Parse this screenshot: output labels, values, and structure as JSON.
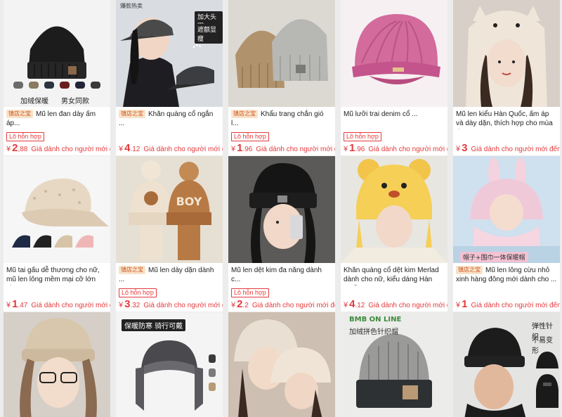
{
  "products": [
    {
      "img_text": [
        "加绒保暖",
        "男女同款"
      ],
      "img_tag": "",
      "shop_tag": "镇店之宝",
      "title": "Mũ len đan dày ấm áp...",
      "badge": "Lô hỗn hợp",
      "currency": "¥",
      "price_int": "2",
      "price_dec": ",88",
      "note": "Giá dành cho người mới đến",
      "icon": "beanie-hat-icon"
    },
    {
      "img_text": [
        "加大头围",
        "遮额显瘦"
      ],
      "img_tag": "爆款热卖",
      "shop_tag": "镇店之宝",
      "title": "Khăn quàng cổ ngắn ...",
      "badge": "",
      "currency": "¥",
      "price_int": "4",
      "price_dec": ".12",
      "note": "Giá dành cho người mới đến",
      "icon": "baseball-cap-icon"
    },
    {
      "img_text": [],
      "img_tag": "",
      "shop_tag": "镇店之宝",
      "title": "Khẩu trang chắn gió l...",
      "badge": "Lô hỗn hợp",
      "currency": "¥",
      "price_int": "1",
      "price_dec": ".96",
      "note": "Giá dành cho người mới đến",
      "icon": "knit-hat-icon"
    },
    {
      "img_text": [],
      "img_tag": "",
      "shop_tag": "",
      "title": "Mũ lưỡi trai denim cổ ...",
      "badge": "Lô hỗn hợp",
      "currency": "¥",
      "price_int": "1",
      "price_dec": ".96",
      "note": "Giá dành cho người mới đến",
      "icon": "newsboy-cap-icon"
    },
    {
      "img_text": [],
      "img_tag": "",
      "shop_tag": "",
      "title": "Mũ len kiểu Hàn Quốc, ấm áp và dày dặn, thích hợp cho mùa thu...",
      "badge": "",
      "currency": "¥",
      "price_int": "3",
      "price_dec": "",
      "note": "Giá dành cho người mới đến",
      "icon": "plush-hat-icon"
    },
    {
      "img_text": [],
      "img_tag": "",
      "shop_tag": "",
      "title": "Mũ tai gấu dễ thương cho nữ, mũ len lông mềm mại cỡ lớn cho ...",
      "badge": "",
      "currency": "¥",
      "price_int": "1",
      "price_dec": ".47",
      "note": "Giá dành cho người mới đến",
      "icon": "teddy-cap-icon"
    },
    {
      "img_text": [],
      "img_tag": "",
      "shop_tag": "镇店之宝",
      "title": "Mũ len dày dặn dành ...",
      "badge": "Lô hỗn hợp",
      "currency": "¥",
      "price_int": "3",
      "price_dec": ".32",
      "note": "Giá dành cho người mới đến",
      "icon": "pompom-hat-icon"
    },
    {
      "img_text": [],
      "img_tag": "",
      "shop_tag": "",
      "title": "Mũ len dệt kim đa năng dành c...",
      "badge": "Lô hỗn hợp",
      "currency": "¥",
      "price_int": "2",
      "price_dec": ".2",
      "note": "Giá dành cho người mới đến",
      "icon": "dark-beanie-icon"
    },
    {
      "img_text": [],
      "img_tag": "",
      "shop_tag": "",
      "title": "Khăn quàng cổ dệt kim Merlad dành cho nữ, kiểu dáng Hàn Quố...",
      "badge": "",
      "currency": "¥",
      "price_int": "4",
      "price_dec": ".12",
      "note": "Giá dành cho người mới đến",
      "icon": "bear-hat-icon"
    },
    {
      "img_text": [
        "帽子+围巾一体保暖帽"
      ],
      "img_tag": "",
      "shop_tag": "镇店之宝",
      "title": "Mũ len lông cừu nhỏ xinh hàng đông mới dành cho ...",
      "badge": "",
      "currency": "¥",
      "price_int": "1",
      "price_dec": "",
      "note": "Giá dành cho người mới đến",
      "icon": "bunny-hat-icon"
    },
    {
      "img_text": [],
      "img_tag": "",
      "shop_tag": "",
      "title": "",
      "badge": "",
      "currency": "",
      "price_int": "",
      "price_dec": "",
      "note": "",
      "icon": "fluffy-beanie-icon"
    },
    {
      "img_text": [
        "保暖防寒 骑行可戴"
      ],
      "img_tag": "",
      "shop_tag": "",
      "title": "",
      "badge": "",
      "currency": "",
      "price_int": "",
      "price_dec": "",
      "note": "",
      "icon": "trapper-hat-icon"
    },
    {
      "img_text": [],
      "img_tag": "",
      "shop_tag": "",
      "title": "",
      "badge": "",
      "currency": "",
      "price_int": "",
      "price_dec": "",
      "note": "",
      "icon": "earflap-hat-icon"
    },
    {
      "img_text": [
        "BMB ON LINE",
        "加绒拼色针织帽"
      ],
      "img_tag": "",
      "shop_tag": "",
      "title": "",
      "badge": "",
      "currency": "",
      "price_int": "",
      "price_dec": "",
      "note": "",
      "icon": "twotone-beanie-icon"
    },
    {
      "img_text": [
        "弹性针织",
        "不易变形"
      ],
      "img_tag": "",
      "shop_tag": "",
      "title": "",
      "badge": "",
      "currency": "",
      "price_int": "",
      "price_dec": "",
      "note": "",
      "icon": "balaclava-icon"
    }
  ],
  "colors": {
    "price": "#e4393c",
    "shop_tag_bg": "#f7e3c9",
    "shop_tag_text": "#d2531e",
    "background": "#ececec"
  }
}
